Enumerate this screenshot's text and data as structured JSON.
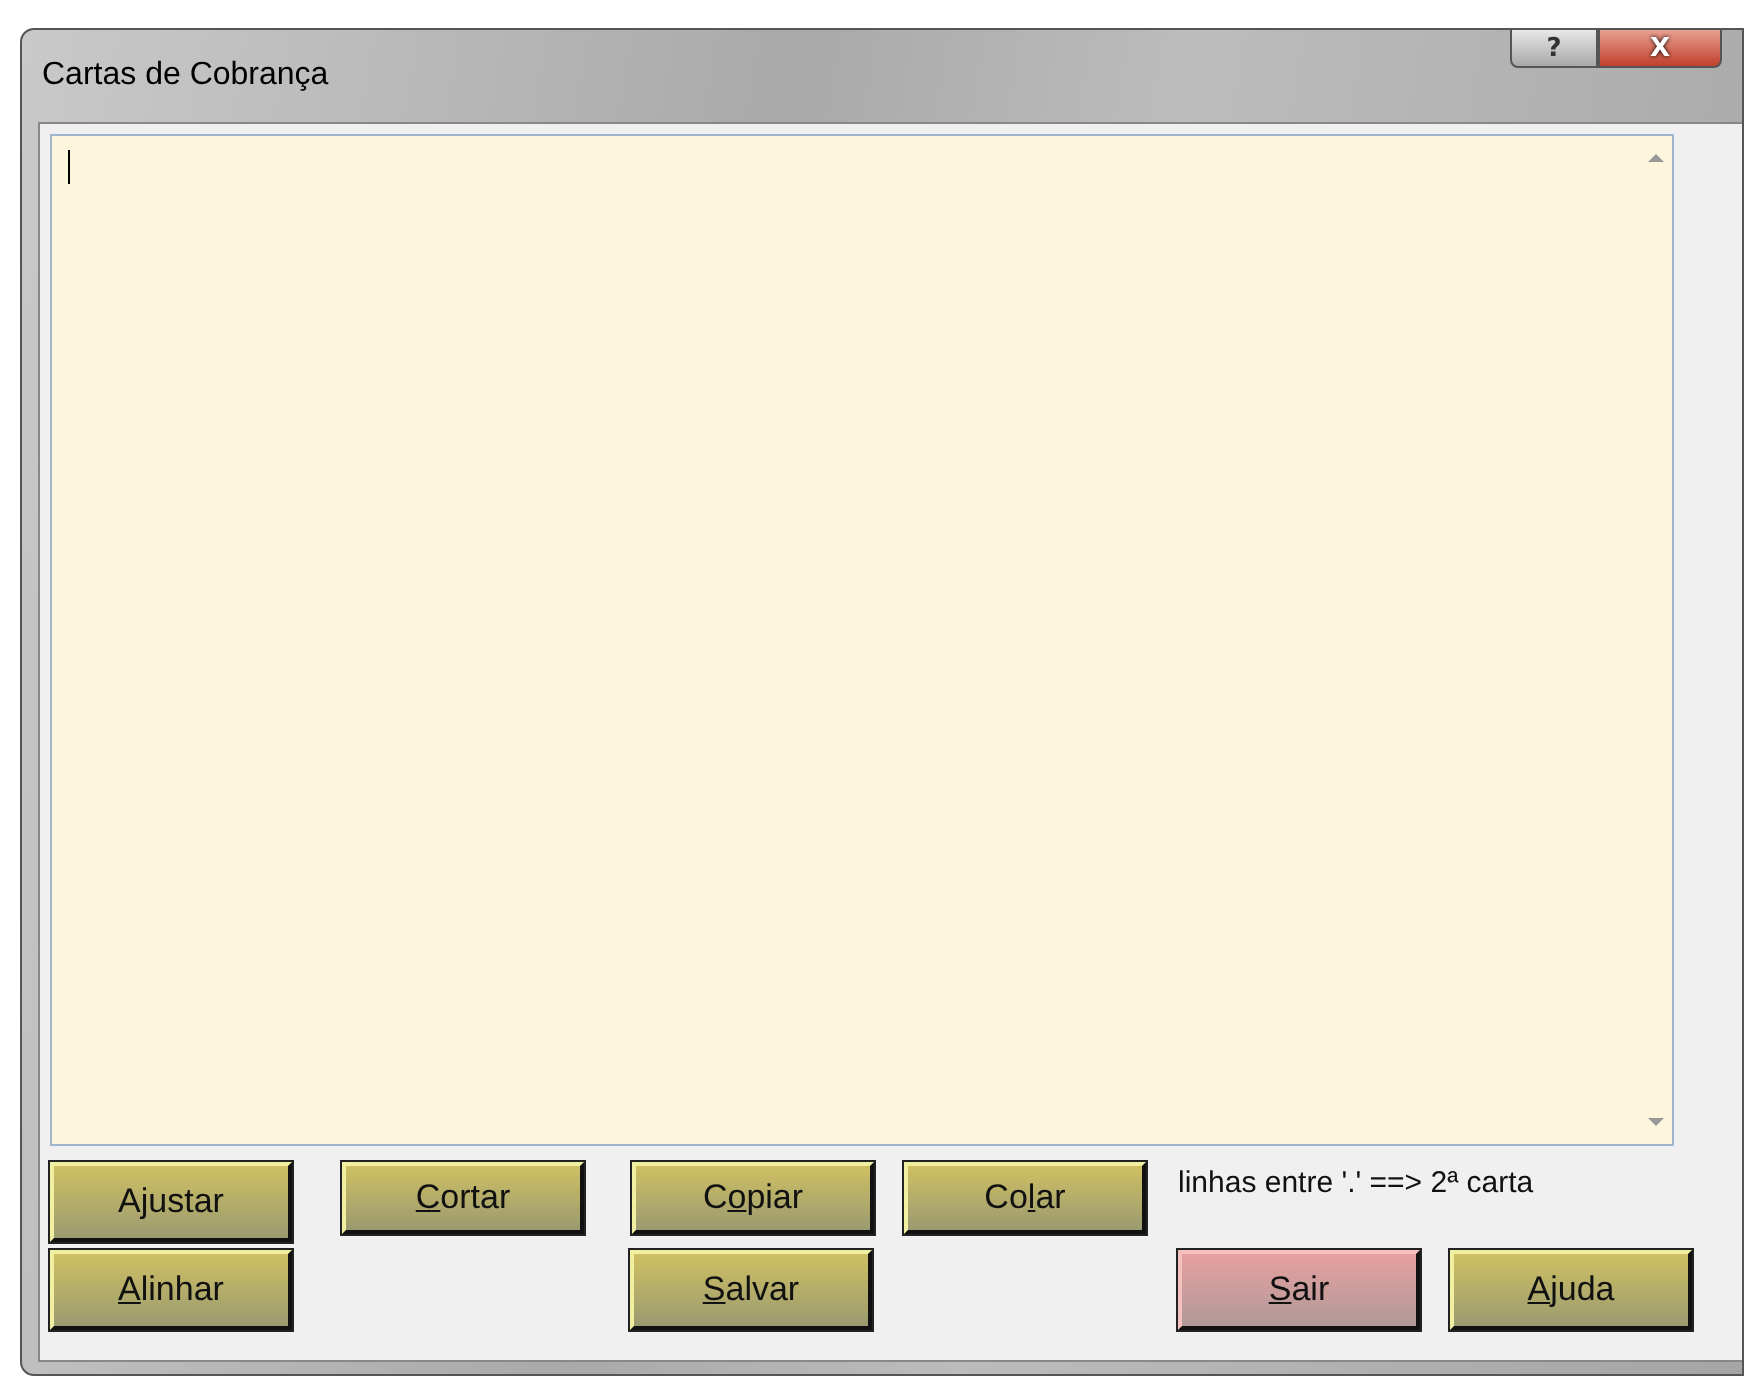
{
  "window": {
    "title": "Cartas de Cobrança",
    "controls": [
      {
        "kind": "help",
        "label": "?"
      },
      {
        "kind": "close",
        "label": "X"
      }
    ]
  },
  "editor": {
    "focused": true
  },
  "button_rows": [
    {
      "buttons": [
        {
          "kind": "default",
          "before": "A",
          "key": "j",
          "after": "ustar"
        },
        {
          "kind": "default",
          "key": "C",
          "after": "ortar"
        },
        {
          "kind": "default",
          "before": "C",
          "key": "o",
          "after": "piar"
        },
        {
          "kind": "default",
          "before": "Co",
          "key": "l",
          "after": "ar"
        }
      ],
      "note": "linhas entre '.' ==> 2ª carta"
    },
    {
      "buttons": [
        {
          "kind": "default",
          "key": "A",
          "after": "linhar"
        },
        {
          "kind": "default",
          "key": "S",
          "after": "alvar"
        },
        {
          "kind": "danger",
          "key": "S",
          "after": "air"
        },
        {
          "kind": "default",
          "key": "A",
          "after": "juda"
        }
      ]
    }
  ]
}
